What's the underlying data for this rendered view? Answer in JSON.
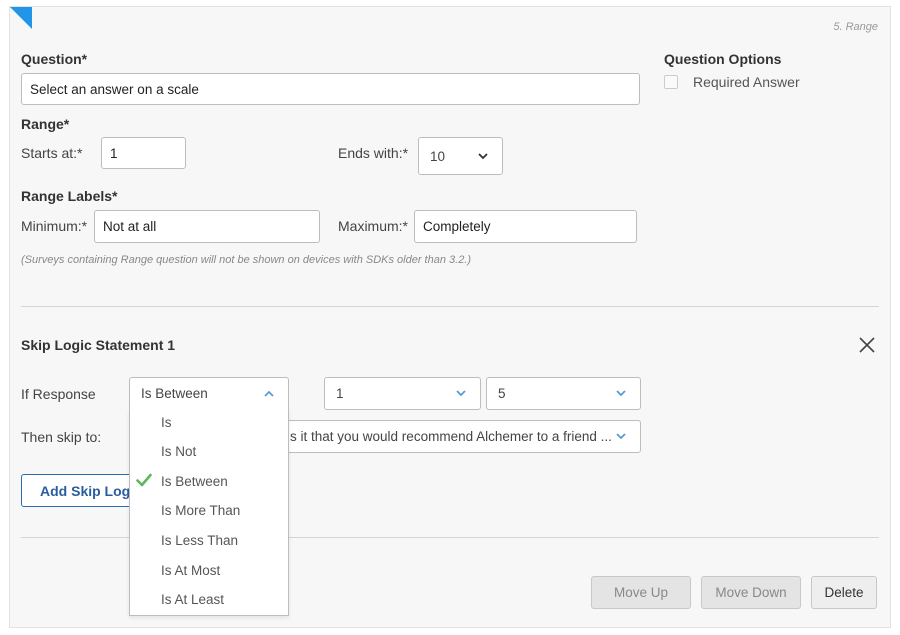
{
  "question_number": "5. Range",
  "question": {
    "label": "Question*",
    "value": "Select an answer on a scale"
  },
  "options": {
    "label": "Question Options",
    "required_answer": {
      "label": "Required Answer",
      "checked": false
    }
  },
  "range": {
    "label": "Range*",
    "starts_label": "Starts at:*",
    "starts_value": "1",
    "ends_label": "Ends with:*",
    "ends_value": "10"
  },
  "range_labels": {
    "label": "Range Labels*",
    "min_label": "Minimum:*",
    "min_value": "Not at all",
    "max_label": "Maximum:*",
    "max_value": "Completely",
    "note": "(Surveys containing Range question will not be shown on devices with SDKs older than 3.2.)"
  },
  "skip_logic": {
    "title": "Skip Logic Statement 1",
    "if_response_label": "If Response",
    "operator_value": "Is Between",
    "value1": "1",
    "value2": "5",
    "then_skip_label": "Then skip to:",
    "skip_target": "s it that you would recommend Alchemer to a friend ...",
    "add_button": "Add Skip Logic",
    "operator_options": [
      "Is",
      "Is Not",
      "Is Between",
      "Is More Than",
      "Is Less Than",
      "Is At Most",
      "Is At Least"
    ],
    "selected_option": "Is Between"
  },
  "footer": {
    "move_up": "Move Up",
    "move_down": "Move Down",
    "delete": "Delete"
  },
  "colors": {
    "accent": "#2196e8",
    "check": "#5cb85c",
    "link_blue": "#2a5d9f"
  }
}
